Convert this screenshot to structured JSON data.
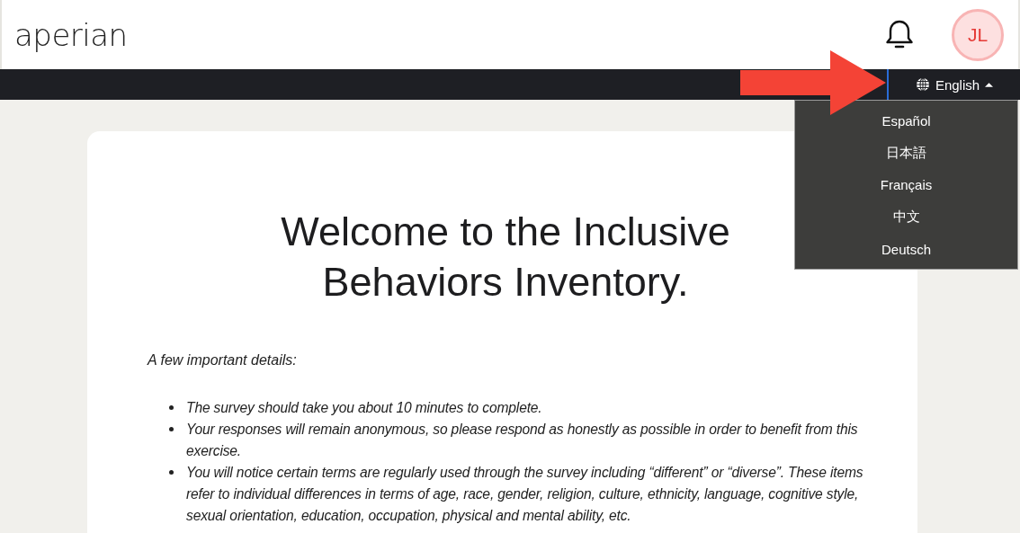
{
  "header": {
    "logo": "aperian",
    "avatar": "JL"
  },
  "language_button": {
    "label": "English",
    "expanded": true
  },
  "language_menu": [
    "Español",
    "日本語",
    "Français",
    "中文",
    "Deutsch"
  ],
  "card": {
    "title": "Welcome to the Inclusive Behaviors Inventory.",
    "intro": "A few important details:",
    "bullets": [
      "The survey should take you about 10 minutes to complete.",
      "Your responses will remain anonymous, so please respond as honestly as possible in order to benefit from this exercise.",
      "You will notice certain terms are regularly used through the survey including “different” or “diverse”. These items refer to individual differences in terms of age, race, gender, religion, culture, ethnicity, language, cognitive style, sexual orientation, education, occupation, physical and mental ability, etc."
    ]
  }
}
